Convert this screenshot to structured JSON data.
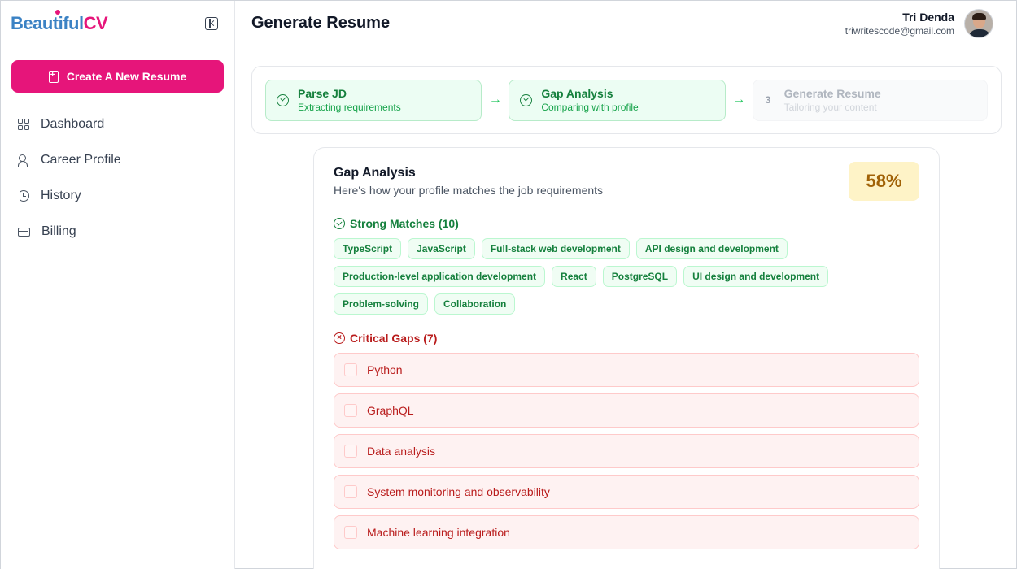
{
  "brand": {
    "part1": "Beautiful",
    "part2": "CV",
    "accent": "#e6157a",
    "blue": "#3b82c4"
  },
  "sidebar": {
    "create_label": "Create A New Resume",
    "items": [
      {
        "label": "Dashboard",
        "icon": "grid-icon"
      },
      {
        "label": "Career Profile",
        "icon": "user-edit-icon"
      },
      {
        "label": "History",
        "icon": "history-icon"
      },
      {
        "label": "Billing",
        "icon": "credit-card-icon"
      }
    ]
  },
  "header": {
    "title": "Generate Resume",
    "user_name": "Tri Denda",
    "user_email": "triwritescode@gmail.com"
  },
  "stepper": {
    "steps": [
      {
        "title": "Parse JD",
        "subtitle": "Extracting requirements",
        "status": "done"
      },
      {
        "title": "Gap Analysis",
        "subtitle": "Comparing with profile",
        "status": "done"
      },
      {
        "number": "3",
        "title": "Generate Resume",
        "subtitle": "Tailoring your content",
        "status": "pending"
      }
    ]
  },
  "gap_analysis": {
    "title": "Gap Analysis",
    "subtitle": "Here's how your profile matches the job requirements",
    "score": "58%",
    "strong_label": "Strong Matches (10)",
    "strong_matches": [
      "TypeScript",
      "JavaScript",
      "Full-stack web development",
      "API design and development",
      "Production-level application development",
      "React",
      "PostgreSQL",
      "UI design and development",
      "Problem-solving",
      "Collaboration"
    ],
    "gaps_label": "Critical Gaps (7)",
    "critical_gaps": [
      "Python",
      "GraphQL",
      "Data analysis",
      "System monitoring and observability",
      "Machine learning integration"
    ]
  }
}
